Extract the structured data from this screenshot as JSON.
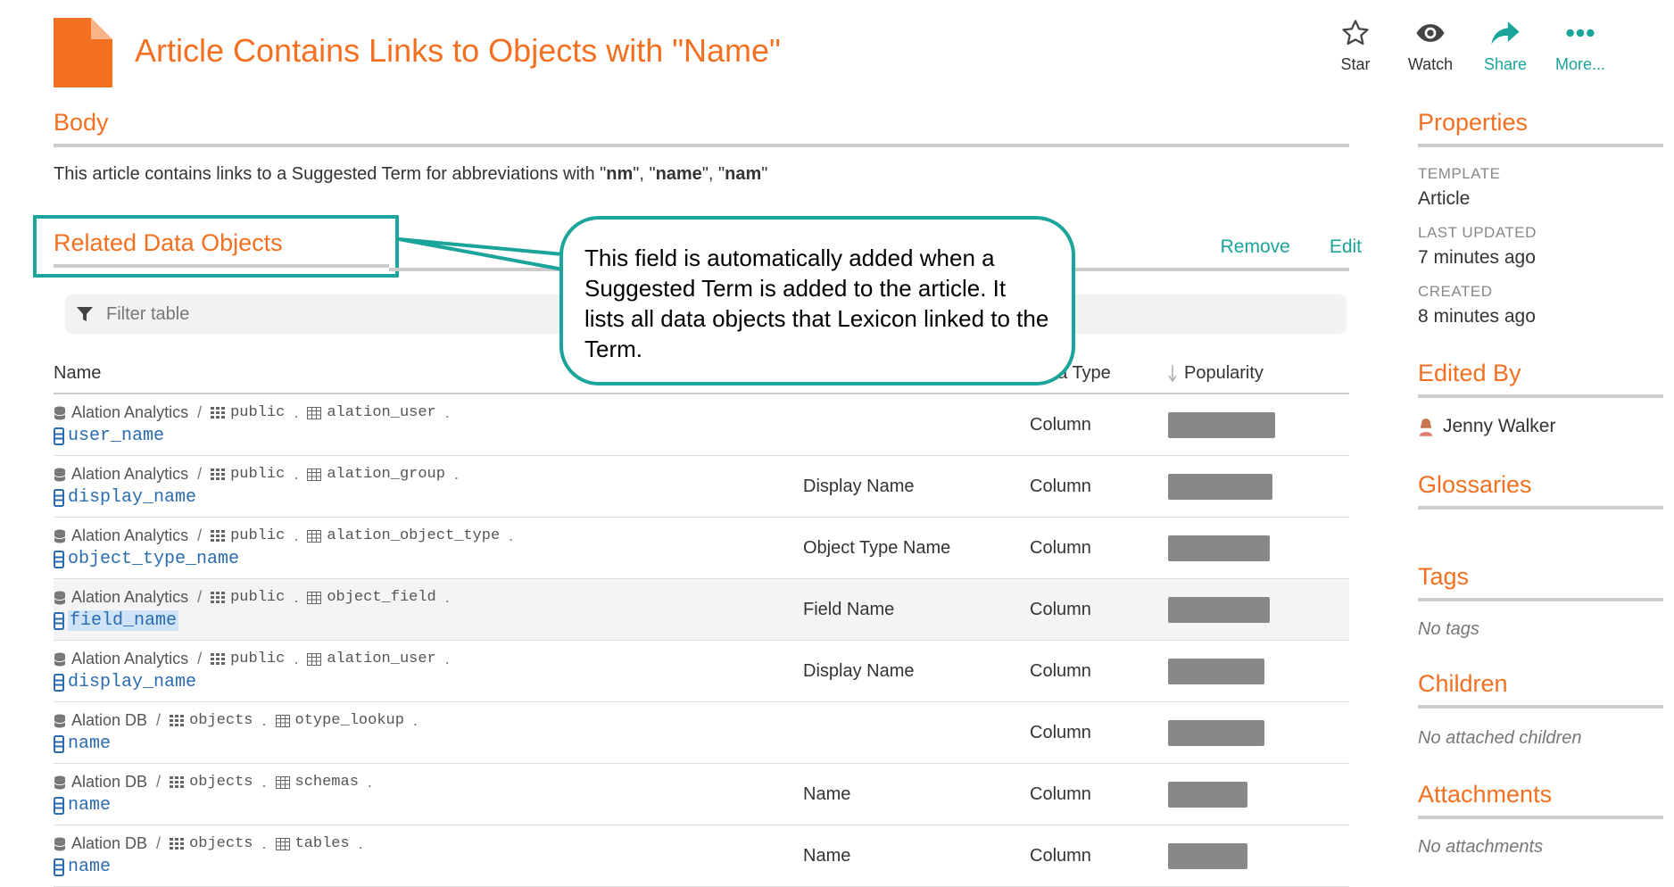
{
  "header": {
    "title": "Article Contains Links to Objects with \"Name\"",
    "actions": [
      {
        "label": "Star",
        "icon": "star-icon"
      },
      {
        "label": "Watch",
        "icon": "eye-icon"
      },
      {
        "label": "Share",
        "icon": "share-icon"
      },
      {
        "label": "More...",
        "icon": "more-icon"
      }
    ]
  },
  "body": {
    "heading": "Body",
    "text_prefix": "This article contains links to a Suggested Term for abbreviations with \"",
    "abbr1": "nm",
    "sep1": "\", \"",
    "abbr2": "name",
    "sep2": "\", \"",
    "abbr3": "nam",
    "text_suffix": "\""
  },
  "related": {
    "heading": "Related Data Objects",
    "remove_label": "Remove",
    "edit_label": "Edit",
    "filter_placeholder": "Filter table",
    "columns": {
      "name": "Name",
      "type": "Data Type",
      "popularity": "Popularity"
    },
    "rows": [
      {
        "source": "Alation Analytics",
        "schema": "public",
        "table": "alation_user",
        "column": "user_name",
        "title": "",
        "type": "Column",
        "popularity": 0.8
      },
      {
        "source": "Alation Analytics",
        "schema": "public",
        "table": "alation_group",
        "column": "display_name",
        "title": "Display Name",
        "type": "Column",
        "popularity": 0.78
      },
      {
        "source": "Alation Analytics",
        "schema": "public",
        "table": "alation_object_type",
        "column": "object_type_name",
        "title": "Object Type Name",
        "type": "Column",
        "popularity": 0.76
      },
      {
        "source": "Alation Analytics",
        "schema": "public",
        "table": "object_field",
        "column": "field_name",
        "title": "Field Name",
        "type": "Column",
        "popularity": 0.76
      },
      {
        "source": "Alation Analytics",
        "schema": "public",
        "table": "alation_user",
        "column": "display_name",
        "title": "Display Name",
        "type": "Column",
        "popularity": 0.72
      },
      {
        "source": "Alation DB",
        "schema": "objects",
        "table": "otype_lookup",
        "column": "name",
        "title": "",
        "type": "Column",
        "popularity": 0.72
      },
      {
        "source": "Alation DB",
        "schema": "objects",
        "table": "schemas",
        "column": "name",
        "title": "Name",
        "type": "Column",
        "popularity": 0.59
      },
      {
        "source": "Alation DB",
        "schema": "objects",
        "table": "tables",
        "column": "name",
        "title": "Name",
        "type": "Column",
        "popularity": 0.59
      }
    ]
  },
  "callout": {
    "text": "This field is automatically added when a Suggested Term is added to the article. It lists all data objects that Lexicon linked to the Term."
  },
  "sidebar": {
    "properties_heading": "Properties",
    "template_label": "TEMPLATE",
    "template_value": "Article",
    "updated_label": "LAST UPDATED",
    "updated_value": "7 minutes ago",
    "created_label": "CREATED",
    "created_value": "8 minutes ago",
    "edited_by_heading": "Edited By",
    "editor": "Jenny Walker",
    "glossaries_heading": "Glossaries",
    "tags_heading": "Tags",
    "tags_empty": "No tags",
    "children_heading": "Children",
    "children_empty": "No attached children",
    "attachments_heading": "Attachments",
    "attachments_empty": "No attachments"
  },
  "colors": {
    "accent": "#f37021",
    "link": "#1aa49a",
    "callout_border": "#1aa49a",
    "popularity_bar": "#888888"
  }
}
